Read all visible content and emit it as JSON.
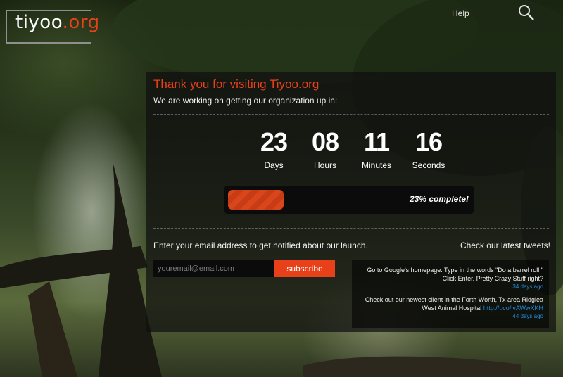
{
  "header": {
    "logo_main": "tiyoo",
    "logo_accent": ".org",
    "help_label": "Help",
    "search_icon": "search-icon"
  },
  "main": {
    "title": "Thank you for visiting Tiyoo.org",
    "subtitle": "We are working on getting our organization up in:",
    "countdown": [
      {
        "value": "23",
        "label": "Days"
      },
      {
        "value": "08",
        "label": "Hours"
      },
      {
        "value": "11",
        "label": "Minutes"
      },
      {
        "value": "16",
        "label": "Seconds"
      }
    ],
    "progress": {
      "percent": 23,
      "text": "23% complete!"
    }
  },
  "subscribe": {
    "label": "Enter your email address to get notified about our launch.",
    "placeholder": "youremail@email.com",
    "button_label": "subscribe"
  },
  "tweets": {
    "label": "Check our latest tweets!",
    "items": [
      {
        "text": "Go to Google's homepage. Type in the words \"Do a barrel roll.\" Click Enter. Pretty Crazy Stuff right?",
        "link": "",
        "time": "34 days ago"
      },
      {
        "text": "Check out our newest client in the Forth Worth, Tx area Ridglea West Animal Hospital",
        "link": "http://t.co/ivAWwXKH",
        "time": "44 days ago"
      }
    ]
  },
  "colors": {
    "accent": "#e8411a",
    "link": "#1e8fe0",
    "panel": "#0f0f0f"
  }
}
